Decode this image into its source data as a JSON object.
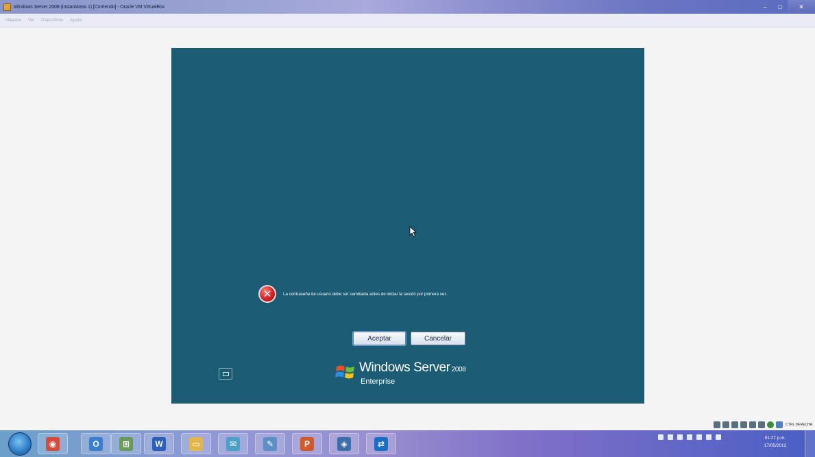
{
  "window": {
    "title": "Windows Server 2008 (Instantánea 1) [Corriendo] - Oracle VM VirtualBox",
    "controls": {
      "minimize": "–",
      "maximize": "□",
      "close": "✕"
    }
  },
  "menubar": {
    "items": [
      "Máquina",
      "Ver",
      "Dispositivos",
      "Ayuda"
    ]
  },
  "guest": {
    "error_message": "La contraseña de usuario debe ser cambiada antes de iniciar la sesión por primera vez.",
    "error_icon": "error-x-icon",
    "ok_label": "Aceptar",
    "cancel_label": "Cancelar",
    "brand": {
      "name": "Windows Server",
      "year": "2008",
      "edition": "Enterprise"
    }
  },
  "vbox_status": {
    "host_key": "CTRL DERECHA"
  },
  "taskbar": {
    "apps": [
      {
        "icon": "chrome-icon",
        "color": "#d64b3a",
        "glyph": "◉"
      },
      {
        "icon": "outlook-icon",
        "color": "#3a7ecf",
        "glyph": "O"
      },
      {
        "icon": "network-icon",
        "color": "#6a9a5a",
        "glyph": "⊞"
      },
      {
        "icon": "word-icon",
        "color": "#2b5fb8",
        "glyph": "W"
      },
      {
        "icon": "folder-icon",
        "color": "#e2b64a",
        "glyph": "▭"
      },
      {
        "icon": "messenger-icon",
        "color": "#4aa0c8",
        "glyph": "✉"
      },
      {
        "icon": "notes-icon",
        "color": "#5a8fc8",
        "glyph": "✎"
      },
      {
        "icon": "powerpoint-icon",
        "color": "#d05a2a",
        "glyph": "P"
      },
      {
        "icon": "virtualbox-icon",
        "color": "#3c6ea8",
        "glyph": "◈"
      },
      {
        "icon": "teamviewer-icon",
        "color": "#1a6fc4",
        "glyph": "⇄"
      }
    ],
    "clock_time": "01:27 p.m.",
    "clock_date": "17/05/2012"
  }
}
